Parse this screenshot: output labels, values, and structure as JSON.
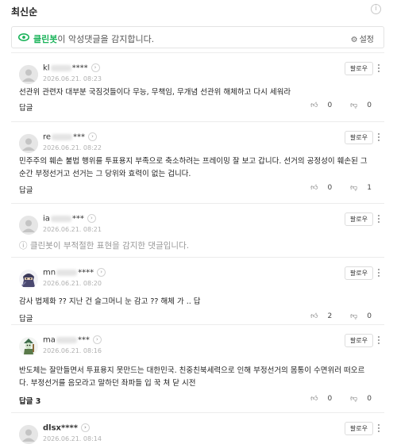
{
  "header": {
    "sort_label": "최신순",
    "info_icon": "info-icon"
  },
  "cleanbot": {
    "brand": "클린봇",
    "message": "이 악성댓글을 감지합니다.",
    "settings_label": "설정"
  },
  "comments": [
    {
      "user_prefix": "kl",
      "user_suffix": "****",
      "date": "2026.06.21. 08:23",
      "follow": "팔로우",
      "text": "선관위 관련자 대부분 국짐것들이다 무능, 무책임, 무개념 선관위 해체하고 다시 세워라",
      "reply": "답글",
      "likes": "0",
      "dislikes": "0",
      "avatar": "default"
    },
    {
      "user_prefix": "re",
      "user_suffix": "***",
      "date": "2026.06.21. 08:22",
      "follow": "팔로우",
      "text": "민주주의 훼손 불법 행위를 투표용지 부족으로 축소하려는 프레이밍 잘 보고 갑니다. 선거의 공정성이 훼손된 그 순간 부정선거고 선거는 그 당위와 효력이 없는 겁니다.",
      "reply": "답글",
      "likes": "0",
      "dislikes": "1",
      "avatar": "default"
    },
    {
      "user_prefix": "ia",
      "user_suffix": "***",
      "date": "2026.06.21. 08:21",
      "follow": "팔로우",
      "cleanbot_note": "클린봇이 부적절한 표현을 감지한 댓글입니다.",
      "avatar": "default"
    },
    {
      "user_prefix": "mn",
      "user_suffix": "****",
      "date": "2026.06.21. 08:20",
      "follow": "팔로우",
      "text": "감사 법제화 ?? 지난 건 슬그머니 눈 감고 ?? 해체 가 .. 답",
      "reply": "답글",
      "likes": "2",
      "dislikes": "0",
      "avatar": "character-ninja"
    },
    {
      "user_prefix": "ma",
      "user_suffix": "***",
      "date": "2026.06.21. 08:16",
      "follow": "팔로우",
      "text": "반도체는 잘만들면서 투표용지 못만드는 대한민국. 친중친북세력으로 인해 부정선거의 몸통이 수면위러 떠오르다. 부정선거를 음모라고 말하던 좌파들 입 꾹 쳐 닫 시전",
      "reply": "답글 3",
      "likes": "0",
      "dislikes": "0",
      "avatar": "character-gnome"
    },
    {
      "user_prefix": "dlsx",
      "user_suffix": "****",
      "date": "2026.06.21. 08:14",
      "follow": "팔로우",
      "avatar": "default"
    }
  ]
}
